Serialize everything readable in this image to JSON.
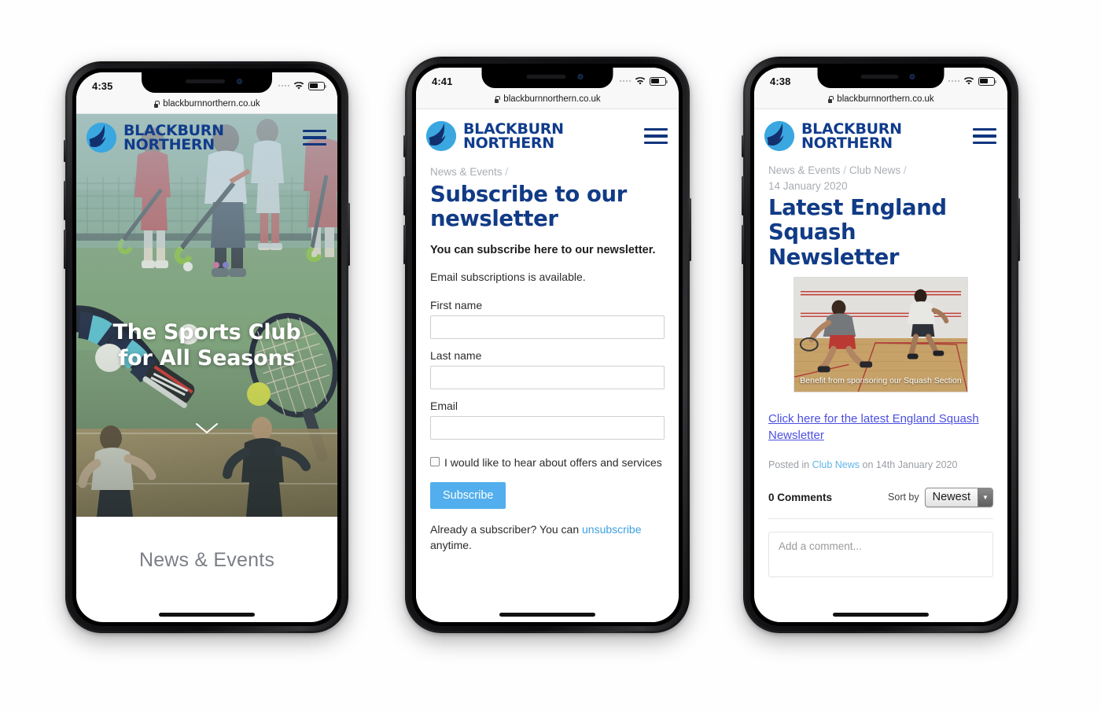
{
  "site": {
    "brand_line1": "BLACKBURN",
    "brand_line2": "NORTHERN",
    "url": "blackburnnorthern.co.uk",
    "accent_navy": "#113b86",
    "accent_light_blue": "#52aeec",
    "logo_icon": "wave-logo-icon",
    "menu_icon": "hamburger-menu-icon",
    "lock_icon": "lock-icon",
    "wifi_icon": "wifi-icon",
    "battery_icon": "battery-icon"
  },
  "phones": [
    {
      "status_time": "4:35",
      "url": "blackburnnorthern.co.uk",
      "screen": "home",
      "hero": {
        "title_line1": "The Sports Club",
        "title_line2": "for All Seasons",
        "scroll_icon": "chevron-down-icon"
      },
      "section_heading": "News & Events"
    },
    {
      "status_time": "4:41",
      "url": "blackburnnorthern.co.uk",
      "screen": "newsletter-signup",
      "breadcrumb": [
        "News & Events",
        "/"
      ],
      "title": "Subscribe to our newsletter",
      "lead": "You can subscribe here to our newsletter.",
      "paragraph": "Email subscriptions is available.",
      "fields": [
        {
          "label": "First name",
          "value": "",
          "placeholder": ""
        },
        {
          "label": "Last name",
          "value": "",
          "placeholder": ""
        },
        {
          "label": "Email",
          "value": "",
          "placeholder": ""
        }
      ],
      "checkbox": {
        "label": "I would like to hear about offers and services",
        "checked": false
      },
      "submit_label": "Subscribe",
      "footer_prefix": "Already a subscriber? You can ",
      "footer_link": "unsubscribe",
      "footer_suffix": " anytime."
    },
    {
      "status_time": "4:38",
      "url": "blackburnnorthern.co.uk",
      "screen": "article",
      "breadcrumb_1": "News & Events",
      "breadcrumb_sep_1": "/",
      "breadcrumb_2": "Club News",
      "breadcrumb_sep_2": "/",
      "breadcrumb_date": "14 January 2020",
      "title": "Latest England Squash Newsletter",
      "image_caption": "Benefit from sponsoring our Squash Section",
      "image_alt": "squash-court-players-photo",
      "doc_link": "Click here for the latest England Squash Newsletter",
      "posted_prefix": "Posted in ",
      "posted_category": "Club News",
      "posted_suffix": " on 14th January 2020",
      "comments": {
        "count_label": "0 Comments",
        "sort_label": "Sort by",
        "sort_value": "Newest",
        "sort_arrow_icon": "chevron-down-icon",
        "input_placeholder": "Add a comment..."
      }
    }
  ]
}
